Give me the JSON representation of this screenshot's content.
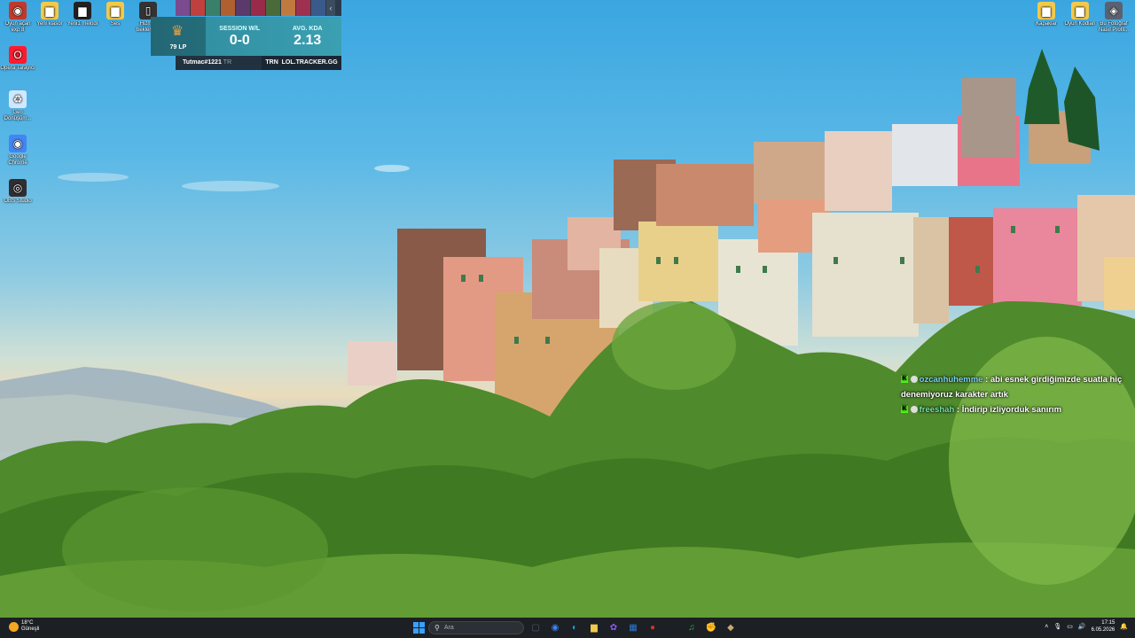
{
  "desktop_left": [
    {
      "label": "Oyun açan exp 8",
      "icon": "game-icon",
      "color": "#c0392b"
    },
    {
      "label": "Yeni klasör",
      "icon": "folder-icon",
      "color": "#f2c94c"
    },
    {
      "label": "Yeni1 melodi",
      "icon": "folder-dark-icon",
      "color": "#222222"
    },
    {
      "label": "Ses",
      "icon": "folder-icon",
      "color": "#f2c94c"
    },
    {
      "label": "Hizmet beklenme",
      "icon": "file-icon",
      "color": "#333333"
    },
    {
      "label": "Opera Tarayıcı",
      "icon": "opera-icon",
      "color": "#ff1b2d"
    },
    {
      "label": "Geri Dönüşüm...",
      "icon": "recycle-bin-icon",
      "color": "#cfe8ff"
    },
    {
      "label": "Google Chrome",
      "icon": "chrome-icon",
      "color": "#4285f4"
    },
    {
      "label": "OBS Studio",
      "icon": "obs-icon",
      "color": "#302e31"
    }
  ],
  "desktop_right": [
    {
      "label": "Kapaklar",
      "icon": "folder-icon",
      "color": "#f2c94c"
    },
    {
      "label": "Oyun Kodları",
      "icon": "folder-icon",
      "color": "#f2c94c"
    },
    {
      "label": "Bu Fotoğraf Nasıl Profil...",
      "icon": "photo-app-icon",
      "color": "#5a6170"
    }
  ],
  "overlay": {
    "lp": "79 LP",
    "session_label": "SESSION W/L",
    "session_value": "0-0",
    "kda_label": "AVG. KDA",
    "kda_value": "2.13",
    "summoner": "Tutmac#1221",
    "summoner_region": "TR",
    "region": "TRN",
    "tracker": "LOL.TRACKER.GG",
    "champion_colors": [
      "#7a4b8f",
      "#c04040",
      "#3a7f6a",
      "#b06030",
      "#5a3a6a",
      "#9a2a4a",
      "#4a6a3a",
      "#c07a40",
      "#a03050",
      "#3a5a8a"
    ]
  },
  "chat": [
    {
      "user": "ozcanhuhemme",
      "message": ": abi esnek girdiğimizde suatla hiç denemiyoruz karakter artık"
    },
    {
      "user": "freeshah",
      "message": ": İndirip izliyorduk sanırım"
    }
  ],
  "taskbar": {
    "weather_temp": "18°C",
    "weather_desc": "Güneşli",
    "search_placeholder": "Ara",
    "apps": [
      {
        "name": "task-view-icon",
        "color": "#555a66",
        "glyph": "▢"
      },
      {
        "name": "chrome-taskbar-icon",
        "color": "#4285f4",
        "glyph": "◉"
      },
      {
        "name": "edge-taskbar-icon",
        "color": "#1ea2d4",
        "glyph": "◐"
      },
      {
        "name": "file-explorer-icon",
        "color": "#f2c94c",
        "glyph": "▆"
      },
      {
        "name": "photos-taskbar-icon",
        "color": "#8a5cf6",
        "glyph": "✿"
      },
      {
        "name": "store-taskbar-icon",
        "color": "#2a7ad4",
        "glyph": "▦"
      },
      {
        "name": "game-taskbar-icon",
        "color": "#c0392b",
        "glyph": "●"
      },
      {
        "name": "steam-taskbar-icon",
        "color": "#1b2838",
        "glyph": "♨"
      },
      {
        "name": "spotify-taskbar-icon",
        "color": "#1db954",
        "glyph": "♫"
      },
      {
        "name": "riot-taskbar-icon",
        "color": "#d13639",
        "glyph": "✊"
      },
      {
        "name": "league-taskbar-icon",
        "color": "#c8aa6e",
        "glyph": "◆"
      }
    ],
    "time": "17:15",
    "date": "6.05.2026"
  }
}
